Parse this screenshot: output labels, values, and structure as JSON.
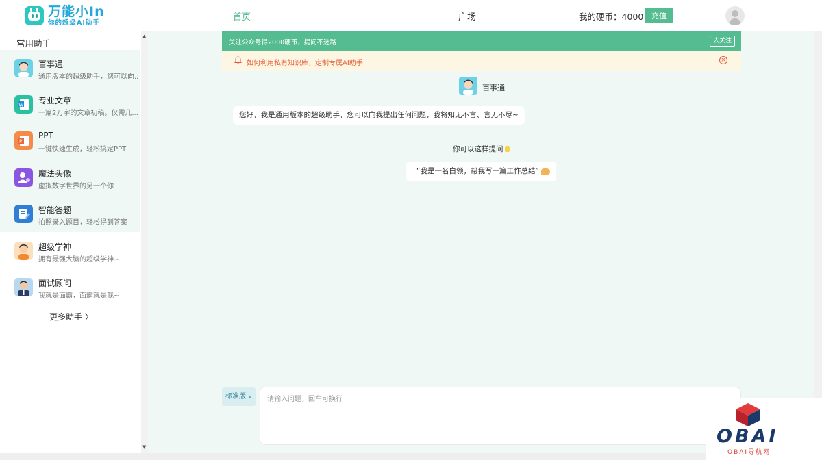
{
  "header": {
    "logo_title": "万能小In",
    "logo_subtitle": "你的超级AI助手",
    "nav_home": "首页",
    "nav_plaza": "广场",
    "coins_label": "我的硬币：4000",
    "recharge_label": "充值",
    "accent_color": "#55bb91"
  },
  "sidebar": {
    "title": "常用助手",
    "items": [
      {
        "name": "百事通",
        "desc": "通用版本的超级助手，您可以向...",
        "icon": "boy-avatar-icon"
      },
      {
        "name": "专业文章",
        "desc": "一篇2万字的文章初稿，仅需几...",
        "icon": "word-doc-icon"
      },
      {
        "name": "PPT",
        "desc": "一键快速生成，轻松搞定PPT",
        "icon": "ppt-icon"
      },
      {
        "name": "魔法头像",
        "desc": "虚拟数字世界的另一个你",
        "icon": "magic-avatar-icon"
      },
      {
        "name": "智能答题",
        "desc": "拍照录入题目，轻松得到答案",
        "icon": "quiz-icon"
      },
      {
        "name": "超级学神",
        "desc": "拥有最强大脑的超级学神~",
        "icon": "scholar-avatar-icon"
      },
      {
        "name": "面试顾问",
        "desc": "我就是面霸，面霸就是我~",
        "icon": "interviewer-avatar-icon"
      }
    ],
    "more_label": "更多助手 〉"
  },
  "notices": {
    "green_text": "关注公众号得2000硬币，提问不迷路",
    "green_button": "去关注",
    "yellow_text": "如何利用私有知识库，定制专属AI助手"
  },
  "chat": {
    "bot_name": "百事通",
    "greeting": "您好，我是通用版本的超级助手，您可以向我提出任何问题，我将知无不言、言无不尽~",
    "ask_title": "你可以这样提问",
    "example": "“我是一名白领，帮我写一篇工作总结”"
  },
  "composer": {
    "version_label": "标准版",
    "placeholder": "请输入问题，回车可换行"
  },
  "watermark": {
    "text": "OBAI",
    "sub": "OBAI导航网"
  }
}
